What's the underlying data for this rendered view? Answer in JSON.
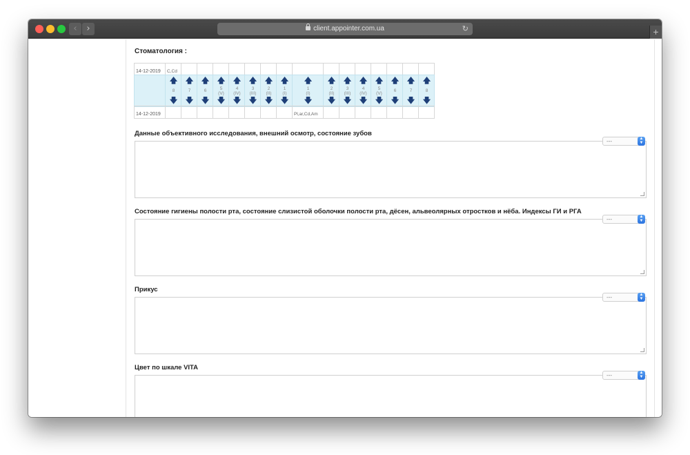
{
  "browser": {
    "url": "client.appointer.com.ua",
    "new_tab_symbol": "+",
    "back_symbol": "‹",
    "forward_symbol": "›",
    "reload_symbol": "↻",
    "traffic_light_colors": [
      "#fe5f57",
      "#febc2e",
      "#28c840"
    ]
  },
  "section": {
    "title": "Стоматология :"
  },
  "dental_chart": {
    "top_row": {
      "date": "14-12-2019",
      "marks": [
        "C,Cd",
        "",
        "",
        "",
        "",
        "",
        "",
        "",
        "",
        "",
        "",
        "",
        "",
        "",
        "",
        "",
        ""
      ]
    },
    "bottom_row": {
      "date": "14-12-2019",
      "marks": [
        "",
        "",
        "",
        "",
        "",
        "",
        "",
        "",
        "Pl,ar,Cd,Am",
        "",
        "",
        "",
        "",
        "",
        "",
        ""
      ]
    },
    "teeth": [
      {
        "num": "8",
        "sub": ""
      },
      {
        "num": "7",
        "sub": ""
      },
      {
        "num": "6",
        "sub": ""
      },
      {
        "num": "5",
        "sub": "(V)"
      },
      {
        "num": "4",
        "sub": "(IV)"
      },
      {
        "num": "3",
        "sub": "(III)"
      },
      {
        "num": "2",
        "sub": "(II)"
      },
      {
        "num": "1",
        "sub": "(I)"
      },
      {
        "num": "1",
        "sub": "(I)"
      },
      {
        "num": "2",
        "sub": "(II)"
      },
      {
        "num": "3",
        "sub": "(III)"
      },
      {
        "num": "4",
        "sub": "(IV)"
      },
      {
        "num": "5",
        "sub": "(V)"
      },
      {
        "num": "6",
        "sub": ""
      },
      {
        "num": "7",
        "sub": ""
      },
      {
        "num": "8",
        "sub": ""
      }
    ],
    "up_arrow": "🡅",
    "down_arrow": "🡇",
    "highlight_color": "#dcf1f8",
    "arrow_color": "#1e3f78"
  },
  "fields": [
    {
      "label": "Данные объективного исследования, внешний осмотр, состояние зубов",
      "select_value": "---",
      "value": ""
    },
    {
      "label": "Состояние гигиены полости рта, состояние слизистой оболочки полости рта, дёсен, альвеолярных отростков и нёба. Индексы ГИ и РГА",
      "select_value": "---",
      "value": ""
    },
    {
      "label": "Прикус",
      "select_value": "---",
      "value": ""
    },
    {
      "label": "Цвет по шкале VITA",
      "select_value": "---",
      "value": ""
    }
  ],
  "select_button_color": "#2b73e0"
}
